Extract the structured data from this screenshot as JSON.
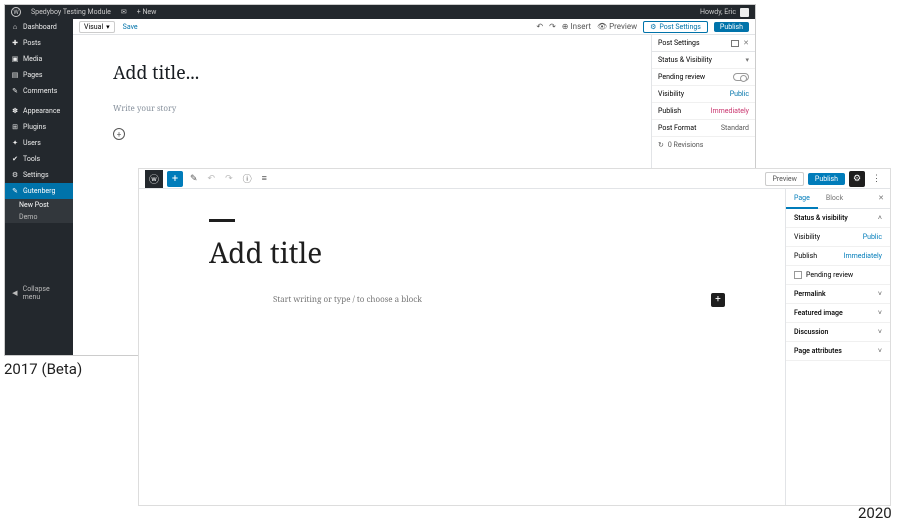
{
  "labels": {
    "beta2017": "2017 (Beta)",
    "y2020": "2020"
  },
  "p17": {
    "adminbar": {
      "site": "Spedyboy Testing Module",
      "new": "+   New",
      "howdy": "Howdy, Eric"
    },
    "sidebar": [
      {
        "icon": "⌂",
        "label": "Dashboard"
      },
      {
        "icon": "✚",
        "label": "Posts"
      },
      {
        "icon": "▣",
        "label": "Media"
      },
      {
        "icon": "▤",
        "label": "Pages"
      },
      {
        "icon": "✎",
        "label": "Comments"
      },
      {
        "icon": "sep",
        "label": ""
      },
      {
        "icon": "✽",
        "label": "Appearance"
      },
      {
        "icon": "⊞",
        "label": "Plugins"
      },
      {
        "icon": "✦",
        "label": "Users"
      },
      {
        "icon": "✔",
        "label": "Tools"
      },
      {
        "icon": "⚙",
        "label": "Settings"
      },
      {
        "icon": "✎",
        "label": "Gutenberg",
        "current": true
      }
    ],
    "sub": {
      "newpost": "New Post",
      "demo": "Demo"
    },
    "collapse": "Collapse menu",
    "toolbar": {
      "visual": "Visual",
      "save": "Save",
      "insert": "Insert",
      "preview": "Preview",
      "postSettings": "Post Settings",
      "publish": "Publish"
    },
    "title_ph": "Add title...",
    "story_ph": "Write your story",
    "panel": {
      "header": "Post Settings",
      "status": "Status & Visibility",
      "pending": "Pending review",
      "visibility": {
        "label": "Visibility",
        "value": "Public"
      },
      "publish": {
        "label": "Publish",
        "value": "Immediately"
      },
      "format": {
        "label": "Post Format",
        "value": "Standard"
      },
      "revisions": "0 Revisions"
    }
  },
  "p20": {
    "toolbar": {
      "preview": "Preview",
      "publish": "Publish"
    },
    "title_ph": "Add title",
    "prompt": "Start writing or type / to choose a block",
    "panel": {
      "tabs": {
        "page": "Page",
        "block": "Block"
      },
      "status": "Status & visibility",
      "visibility": {
        "label": "Visibility",
        "value": "Public"
      },
      "publish": {
        "label": "Publish",
        "value": "Immediately"
      },
      "pending": "Pending review",
      "permalink": "Permalink",
      "featured": "Featured image",
      "discussion": "Discussion",
      "attributes": "Page attributes"
    }
  }
}
